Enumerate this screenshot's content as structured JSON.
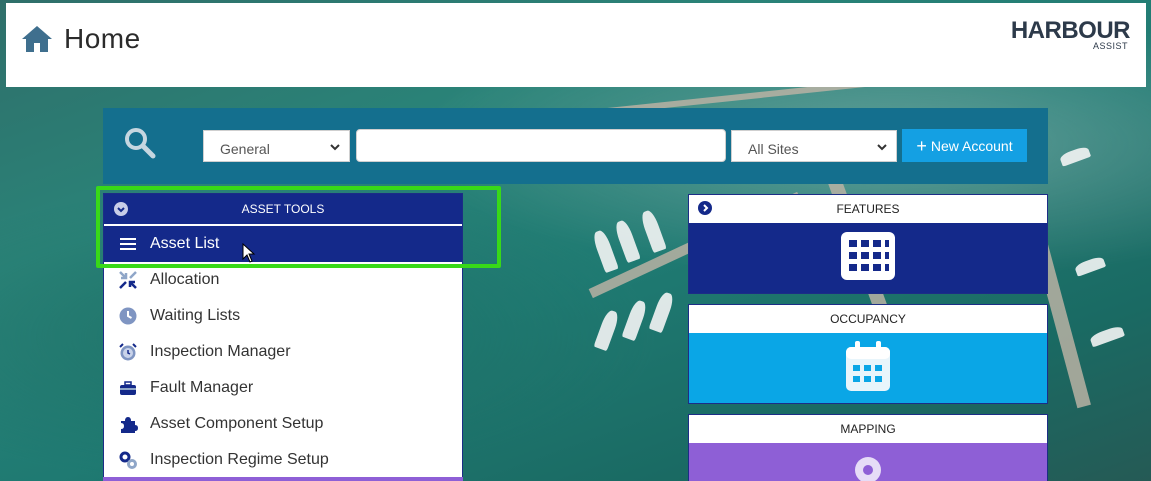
{
  "header": {
    "title": "Home",
    "logo_main": "HARBOUR",
    "logo_sub": "ASSIST"
  },
  "search": {
    "category_value": "General",
    "search_value": "",
    "sites_value": "All Sites",
    "new_account_label": "New Account"
  },
  "asset_tools": {
    "title": "ASSET TOOLS",
    "items": [
      {
        "label": "Asset List",
        "icon": "hamburger-icon",
        "active": true
      },
      {
        "label": "Allocation",
        "icon": "allocation-icon"
      },
      {
        "label": "Waiting Lists",
        "icon": "clock-icon"
      },
      {
        "label": "Inspection Manager",
        "icon": "alarm-clock-icon"
      },
      {
        "label": "Fault Manager",
        "icon": "toolbox-icon"
      },
      {
        "label": "Asset Component Setup",
        "icon": "puzzle-icon"
      },
      {
        "label": "Inspection Regime Setup",
        "icon": "gears-icon"
      }
    ]
  },
  "cards": [
    {
      "title": "FEATURES",
      "icon": "grid-icon",
      "color": "#14298a"
    },
    {
      "title": "OCCUPANCY",
      "icon": "calendar-icon",
      "color": "#0aa6e6"
    },
    {
      "title": "MAPPING",
      "icon": "map-pin-icon",
      "color": "#8e5fd6"
    }
  ],
  "colors": {
    "search_bar": "#146f8e",
    "panel_header": "#14298a",
    "new_account": "#14a0e3",
    "highlight": "#38d918"
  }
}
